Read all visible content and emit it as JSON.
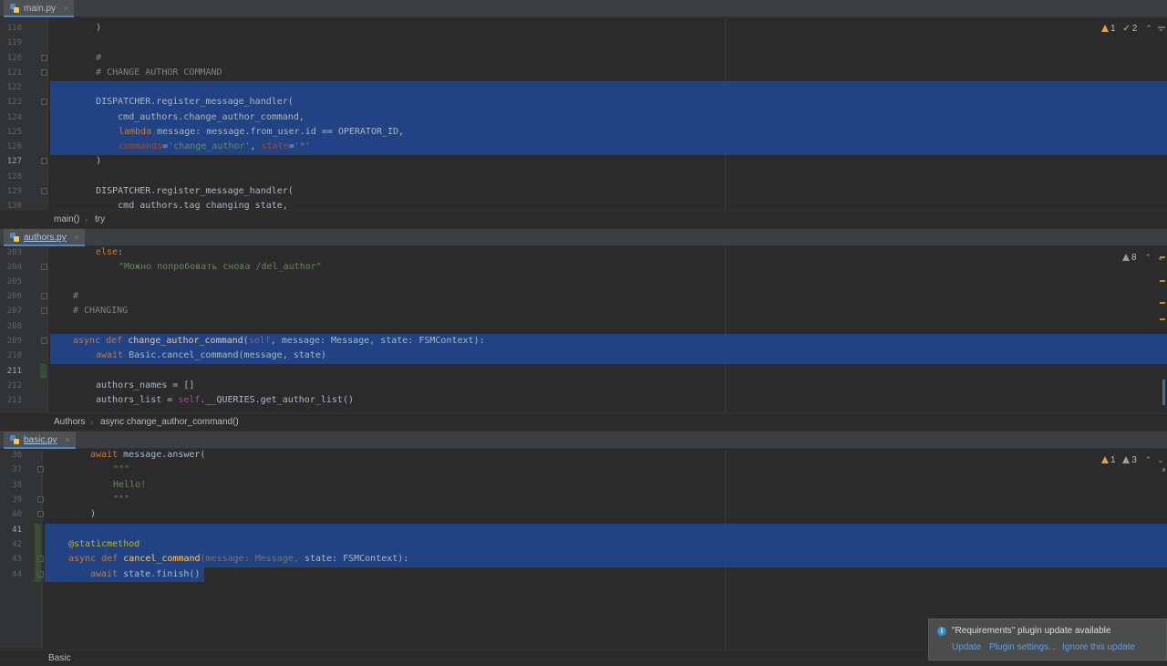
{
  "panes": [
    {
      "tab": {
        "label": "main.py",
        "close": "×"
      },
      "inspections": {
        "warnings": "1",
        "weak": "2"
      },
      "breadcrumb": [
        "main()",
        "try"
      ]
    },
    {
      "tab": {
        "label": "authors.py",
        "close": "×"
      },
      "inspections": {
        "weak": "8"
      },
      "breadcrumb": [
        "Authors",
        "async change_author_command()"
      ]
    },
    {
      "tab": {
        "label": "basic.py",
        "close": "×"
      },
      "inspections": {
        "warnings": "1",
        "weak": "3"
      },
      "breadcrumb": [
        "Basic"
      ]
    }
  ],
  "code1": {
    "n118": "118",
    "n119": "119",
    "n120": "120",
    "n121": "121",
    "n122": "122",
    "n123": "123",
    "n124": "124",
    "n125": "125",
    "n126": "126",
    "n127": "127",
    "n128": "128",
    "n129": "129",
    "n130": "130",
    "l118": "    )",
    "l120": "    #",
    "l121": "    # CHANGE AUTHOR COMMAND",
    "l123": "    DISPATCHER.register_message_handler(",
    "l124": "        cmd_authors.change_author_command,",
    "l125_kw": "lambda",
    "l125_rest": " message: message.from_user.id == OPERATOR_ID,",
    "l126_a": "commands",
    "l126_b": "=",
    "l126_c": "'change_author'",
    "l126_d": ", ",
    "l126_e": "state",
    "l126_f": "=",
    "l126_g": "'*'",
    "l127": "    )",
    "l129": "    DISPATCHER.register_message_handler(",
    "l130": "        cmd_authors.tag_changing_state,"
  },
  "code2": {
    "n203": "203",
    "n204": "204",
    "n205": "205",
    "n206": "206",
    "n207": "207",
    "n208": "208",
    "n209": "209",
    "n210": "210",
    "n211": "211",
    "n212": "212",
    "n213": "213",
    "l203": "else",
    "l203b": ":",
    "l204": "\"Можно попробовать снова /del_author\"",
    "l206": "#",
    "l207": "# CHANGING",
    "l209_async": "async",
    "l209_def": "def",
    "l209_fn": "change_author_command",
    "l209_open": "(",
    "l209_self": "self",
    "l209_rest": ", message: Message, state: FSMContext):",
    "l210_await": "await",
    "l210_rest": " Basic.cancel_command(message, state)",
    "l212": "authors_names = []",
    "l213_a": "authors_list = ",
    "l213_self": "self",
    "l213_b": ".__QUERIES.get_author_list()"
  },
  "code3": {
    "n36": "36",
    "n37": "37",
    "n38": "38",
    "n39": "39",
    "n40": "40",
    "n41": "41",
    "n42": "42",
    "n43": "43",
    "n44": "44",
    "l36_await": "await",
    "l36_rest": " message.answer(",
    "l37": "\"\"\"",
    "l38": "Hello!",
    "l39": "\"\"\"",
    "l40": ")",
    "l42": "@staticmethod",
    "l43_async": "async",
    "l43_def": "def",
    "l43_fn": "cancel_command",
    "l43_dim": "(message: Message,",
    "l43_rest": " state: FSMContext):",
    "l44_await": "await",
    "l44_rest": " state.finish()"
  },
  "notification": {
    "title": "\"Requirements\" plugin update available",
    "links": [
      "Update",
      "Plugin settings...",
      "Ignore this update"
    ]
  },
  "colors": {
    "selection": "#214283",
    "keyword": "#cc7832",
    "string": "#6a8759",
    "function": "#ffc66d",
    "decorator": "#bbb529",
    "link": "#589df6"
  }
}
